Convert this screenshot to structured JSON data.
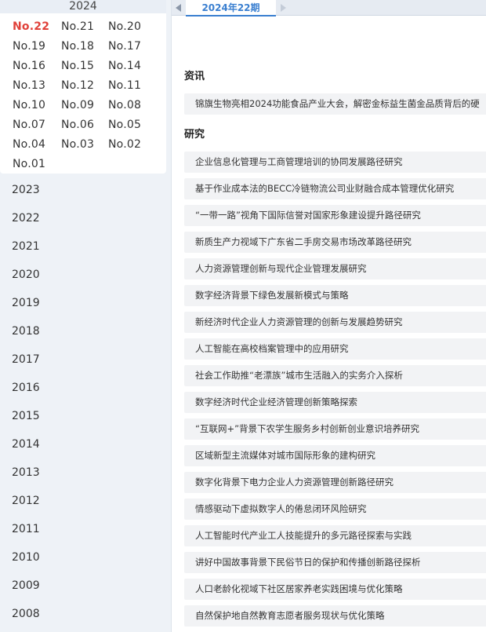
{
  "sidebar": {
    "current_year": "2024",
    "active_issue": "No.22",
    "issues": [
      "No.22",
      "No.21",
      "No.20",
      "No.19",
      "No.18",
      "No.17",
      "No.16",
      "No.15",
      "No.14",
      "No.13",
      "No.12",
      "No.11",
      "No.10",
      "No.09",
      "No.08",
      "No.07",
      "No.06",
      "No.05",
      "No.04",
      "No.03",
      "No.02",
      "No.01"
    ],
    "years": [
      "2023",
      "2022",
      "2021",
      "2020",
      "2019",
      "2018",
      "2017",
      "2016",
      "2015",
      "2014",
      "2013",
      "2012",
      "2011",
      "2010",
      "2009",
      "2008"
    ]
  },
  "topbar": {
    "period_tab": "2024年22期",
    "prev_icon": "triangle-left-icon",
    "next_icon": "triangle-right-icon"
  },
  "main": {
    "sections": [
      {
        "title": "资讯",
        "articles": [
          "锦旗生物亮相2024功能食品产业大会，解密金标益生菌金品质背后的硬"
        ]
      },
      {
        "title": "研究",
        "articles": [
          "企业信息化管理与工商管理培训的协同发展路径研究",
          "基于作业成本法的BECC冷链物流公司业财融合成本管理优化研究",
          "“一带一路”视角下国际信誉对国家形象建设提升路径研究",
          "新质生产力视域下广东省二手房交易市场改革路径研究",
          "人力资源管理创新与现代企业管理发展研究",
          "数字经济背景下绿色发展新模式与策略",
          "新经济时代企业人力资源管理的创新与发展趋势研究",
          "人工智能在高校档案管理中的应用研究",
          "社会工作助推“老漂族”城市生活融入的实务介入探析",
          "数字经济时代企业经济管理创新策略探索",
          "“互联网+”背景下农学生服务乡村创新创业意识培养研究",
          "区域新型主流媒体对城市国际形象的建构研究",
          "数字化背景下电力企业人力资源管理创新路径研究",
          "情感驱动下虚拟数字人的倦怠闭环风险研究",
          "人工智能时代产业工人技能提升的多元路径探索与实践",
          "讲好中国故事背景下民俗节日的保护和传播创新路径探析",
          "人口老龄化视域下社区居家养老实践困境与优化策略",
          "自然保护地自然教育志愿者服务现状与优化策略"
        ]
      }
    ]
  },
  "colors": {
    "accent_blue": "#3a7fd0",
    "active_red": "#e0413a",
    "sidebar_bg": "#eef2f7",
    "article_bg": "#f2f3f5"
  }
}
